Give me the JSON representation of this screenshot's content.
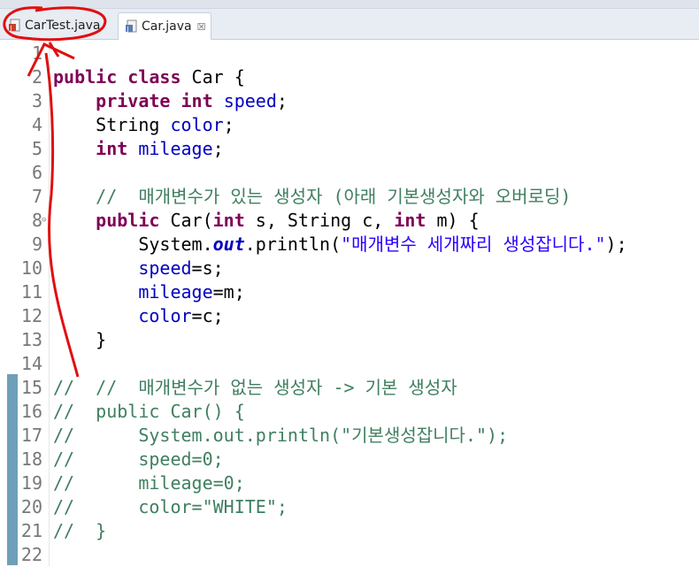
{
  "tabs": [
    {
      "label": "CarTest.java",
      "active": false
    },
    {
      "label": "Car.java",
      "active": true,
      "close": "☒"
    }
  ],
  "lines": [
    {
      "n": "1",
      "segs": []
    },
    {
      "n": "2",
      "segs": [
        [
          "kw",
          "public"
        ],
        [
          "",
          " "
        ],
        [
          "kw",
          "class"
        ],
        [
          "",
          " Car {"
        ]
      ]
    },
    {
      "n": "3",
      "segs": [
        [
          "",
          "    "
        ],
        [
          "kw",
          "private"
        ],
        [
          "",
          " "
        ],
        [
          "kw",
          "int"
        ],
        [
          "",
          " "
        ],
        [
          "fld",
          "speed"
        ],
        [
          "",
          ";"
        ]
      ]
    },
    {
      "n": "4",
      "segs": [
        [
          "",
          "    String "
        ],
        [
          "fld",
          "color"
        ],
        [
          "",
          ";"
        ]
      ]
    },
    {
      "n": "5",
      "segs": [
        [
          "",
          "    "
        ],
        [
          "kw",
          "int"
        ],
        [
          "",
          " "
        ],
        [
          "fld",
          "mileage"
        ],
        [
          "",
          ";"
        ]
      ]
    },
    {
      "n": "6",
      "segs": []
    },
    {
      "n": "7",
      "segs": [
        [
          "",
          "    "
        ],
        [
          "cmt",
          "//  매개변수가 있는 생성자 (아래 기본생성자와 오버로딩)"
        ]
      ]
    },
    {
      "n": "8",
      "fold": "⊖",
      "segs": [
        [
          "",
          "    "
        ],
        [
          "kw",
          "public"
        ],
        [
          "",
          " Car("
        ],
        [
          "kw",
          "int"
        ],
        [
          "",
          " s, String c, "
        ],
        [
          "kw",
          "int"
        ],
        [
          "",
          " m) {"
        ]
      ]
    },
    {
      "n": "9",
      "segs": [
        [
          "",
          "        System."
        ],
        [
          "static",
          "out"
        ],
        [
          "",
          ".println("
        ],
        [
          "str",
          "\"매개변수 세개짜리 생성잡니다.\""
        ],
        [
          "",
          ");"
        ]
      ]
    },
    {
      "n": "10",
      "segs": [
        [
          "",
          "        "
        ],
        [
          "fld",
          "speed"
        ],
        [
          "",
          "=s;"
        ]
      ]
    },
    {
      "n": "11",
      "segs": [
        [
          "",
          "        "
        ],
        [
          "fld",
          "mileage"
        ],
        [
          "",
          "=m;"
        ]
      ]
    },
    {
      "n": "12",
      "segs": [
        [
          "",
          "        "
        ],
        [
          "fld",
          "color"
        ],
        [
          "",
          "=c;"
        ]
      ]
    },
    {
      "n": "13",
      "segs": [
        [
          "",
          "    }"
        ]
      ]
    },
    {
      "n": "14",
      "segs": []
    },
    {
      "n": "15",
      "segs": [
        [
          "cmt",
          "//  //  매개변수가 없는 생성자 -> 기본 생성자"
        ]
      ]
    },
    {
      "n": "16",
      "segs": [
        [
          "cmt",
          "//  public Car() {"
        ]
      ]
    },
    {
      "n": "17",
      "segs": [
        [
          "cmt",
          "//      System.out.println(\"기본생성잡니다.\");"
        ]
      ]
    },
    {
      "n": "18",
      "segs": [
        [
          "cmt",
          "//      speed=0;"
        ]
      ]
    },
    {
      "n": "19",
      "segs": [
        [
          "cmt",
          "//      mileage=0;"
        ]
      ]
    },
    {
      "n": "20",
      "segs": [
        [
          "cmt",
          "//      color=\"WHITE\";"
        ]
      ]
    },
    {
      "n": "21",
      "segs": [
        [
          "cmt",
          "//  }"
        ]
      ]
    },
    {
      "n": "22",
      "segs": []
    }
  ],
  "colors": {
    "keyword": "#7f0055",
    "field": "#0000c0",
    "string": "#2a00ff",
    "comment": "#3f7f5f",
    "annotation": "#e01010"
  },
  "icons": {
    "java_file": "java-file-icon",
    "close": "close-icon"
  }
}
